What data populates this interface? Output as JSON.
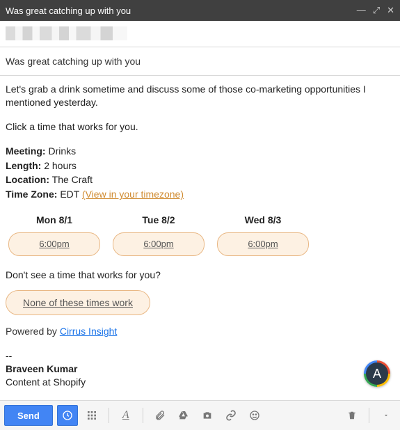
{
  "window": {
    "title": "Was great catching up with you"
  },
  "subject": "Was great catching up with you",
  "body": {
    "intro": "Let's grab a drink sometime and discuss some of those co-marketing opportunities I mentioned yesterday.",
    "prompt": "Click a time that works for you.",
    "meeting_label": "Meeting:",
    "meeting_value": "Drinks",
    "length_label": "Length:",
    "length_value": "2 hours",
    "location_label": "Location:",
    "location_value": "The Craft",
    "tz_label": "Time Zone:",
    "tz_value": "EDT",
    "tz_link": "(View in your timezone)",
    "days": [
      {
        "label": "Mon 8/1",
        "time": "6:00pm"
      },
      {
        "label": "Tue 8/2",
        "time": "6:00pm"
      },
      {
        "label": "Wed 8/3",
        "time": "6:00pm"
      }
    ],
    "no_fit_text": "Don't see a time that works for you?",
    "none_btn": "None of these times work",
    "powered_prefix": "Powered by ",
    "powered_link": "Cirrus Insight",
    "sig_dash": "--",
    "sig_name": "Braveen Kumar",
    "sig_role": "Content at Shopify"
  },
  "avatar": {
    "letter": "A"
  },
  "toolbar": {
    "send": "Send"
  }
}
